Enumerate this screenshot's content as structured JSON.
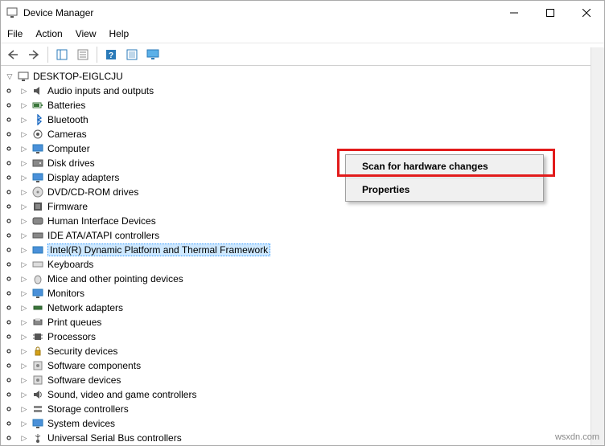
{
  "window": {
    "title": "Device Manager"
  },
  "menu": {
    "file": "File",
    "action": "Action",
    "view": "View",
    "help": "Help"
  },
  "tree": {
    "root": "DESKTOP-EIGLCJU",
    "items": [
      {
        "label": "Audio inputs and outputs"
      },
      {
        "label": "Batteries"
      },
      {
        "label": "Bluetooth"
      },
      {
        "label": "Cameras"
      },
      {
        "label": "Computer"
      },
      {
        "label": "Disk drives"
      },
      {
        "label": "Display adapters"
      },
      {
        "label": "DVD/CD-ROM drives"
      },
      {
        "label": "Firmware"
      },
      {
        "label": "Human Interface Devices"
      },
      {
        "label": "IDE ATA/ATAPI controllers"
      },
      {
        "label": "Intel(R) Dynamic Platform and Thermal Framework",
        "selected": true
      },
      {
        "label": "Keyboards"
      },
      {
        "label": "Mice and other pointing devices"
      },
      {
        "label": "Monitors"
      },
      {
        "label": "Network adapters"
      },
      {
        "label": "Print queues"
      },
      {
        "label": "Processors"
      },
      {
        "label": "Security devices"
      },
      {
        "label": "Software components"
      },
      {
        "label": "Software devices"
      },
      {
        "label": "Sound, video and game controllers"
      },
      {
        "label": "Storage controllers"
      },
      {
        "label": "System devices"
      },
      {
        "label": "Universal Serial Bus controllers"
      }
    ]
  },
  "context_menu": {
    "scan": "Scan for hardware changes",
    "properties": "Properties"
  },
  "watermark": "wsxdn.com"
}
